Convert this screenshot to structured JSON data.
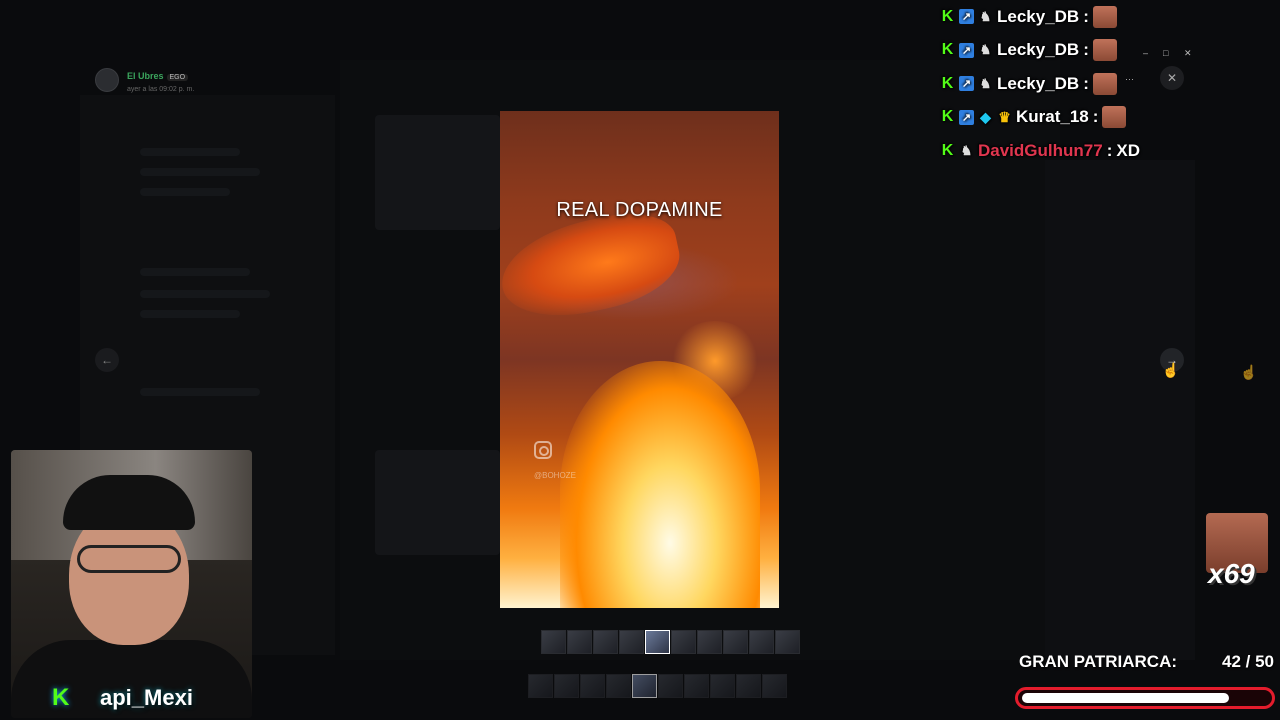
{
  "viewer": {
    "author_name": "El Ubres",
    "author_badge": "EGO",
    "author_time": "ayer a las 09:02 p. m.",
    "video_caption": "REAL DOPAMINE",
    "video_handle": "@BOHOZE",
    "prev_label": "←",
    "next_label": "→",
    "close_label": "✕",
    "window_controls": [
      "–",
      "□",
      "✕"
    ],
    "more_label": "···"
  },
  "chat": {
    "messages": [
      {
        "user": "Lecky_DB",
        "separator": " :",
        "text": "",
        "color": "#ffffff",
        "badges": [
          "k-icon",
          "blue-badge-icon",
          "mouse-icon"
        ],
        "emote": true
      },
      {
        "user": "Lecky_DB",
        "separator": " :",
        "text": "",
        "color": "#ffffff",
        "badges": [
          "k-icon",
          "blue-badge-icon",
          "mouse-icon"
        ],
        "emote": true
      },
      {
        "user": "Lecky_DB",
        "separator": " :",
        "text": "",
        "color": "#ffffff",
        "badges": [
          "k-icon",
          "blue-badge-icon",
          "mouse-icon"
        ],
        "emote": true
      },
      {
        "user": "Kurat_18",
        "separator": " :",
        "text": "",
        "color": "#ffffff",
        "badges": [
          "k-icon",
          "blue-badge-icon",
          "cube-icon",
          "crown-icon"
        ],
        "emote": true
      },
      {
        "user": "DavidGulhun77",
        "separator": " :",
        "text": "XD",
        "color": "#e0364f",
        "badges": [
          "k-icon",
          "mouse-icon"
        ],
        "emote": false
      }
    ]
  },
  "webcam": {
    "label_k": "K",
    "label": "api_Mexi"
  },
  "emote_combo": {
    "text": "x69"
  },
  "goal": {
    "label": "GRAN PATRIARCA:",
    "count": "42 / 50",
    "current": 42,
    "target": 50,
    "bar_color": "#e41c2c"
  },
  "thumbnails": {
    "count": 10,
    "active_index": 4
  }
}
